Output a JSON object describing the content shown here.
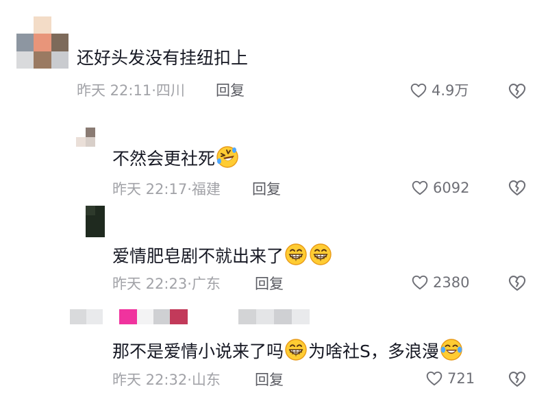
{
  "comments": [
    {
      "text": "还好头发没有挂纽扣上",
      "time": "昨天 22:11",
      "location": "四川",
      "reply_label": "回复",
      "likes": "4.9万"
    },
    {
      "text": "不然会更社死",
      "time": "昨天 22:17",
      "location": "福建",
      "reply_label": "回复",
      "likes": "6092"
    },
    {
      "text": "爱情肥皂剧不就出来了",
      "time": "昨天 22:23",
      "location": "广东",
      "reply_label": "回复",
      "likes": "2380"
    },
    {
      "text_a": "那不是爱情小说来了吗",
      "text_b": "为啥社S，多浪漫",
      "time": "昨天 22:32",
      "location": "山东",
      "reply_label": "回复",
      "likes": "721"
    }
  ],
  "icons": {
    "like": "heart-outline-icon",
    "dislike": "broken-heart-icon",
    "emoji_laugh": "rofl-emoji",
    "emoji_grin": "grin-emoji",
    "emoji_tears": "tears-of-joy-emoji"
  },
  "colors": {
    "primary_text": "#161823",
    "meta_text": "#a1a2a7",
    "reply_text": "#5a5b62"
  }
}
